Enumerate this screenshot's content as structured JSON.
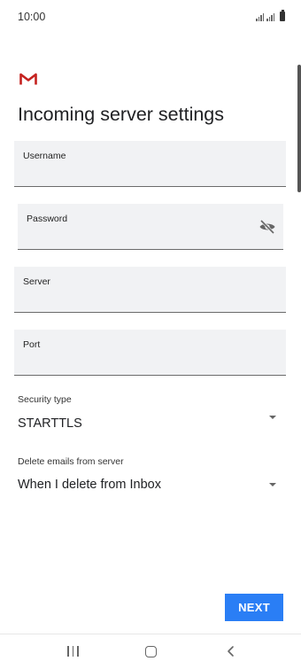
{
  "status_bar": {
    "time": "10:00",
    "signal_icon": "signal-icon",
    "battery_icon": "battery-icon"
  },
  "app": {
    "logo_icon": "gmail-icon",
    "brand_color": "#c5221f"
  },
  "page": {
    "title": "Incoming server settings"
  },
  "form": {
    "username": {
      "label": "Username",
      "value": ""
    },
    "password": {
      "label": "Password",
      "value": "",
      "toggle_icon": "visibility-off-icon"
    },
    "server": {
      "label": "Server",
      "value": ""
    },
    "port": {
      "label": "Port",
      "value": ""
    },
    "security_type": {
      "label": "Security type",
      "value": "STARTTLS"
    },
    "delete_emails": {
      "label": "Delete emails from server",
      "value": "When I delete from Inbox"
    }
  },
  "actions": {
    "next_label": "NEXT",
    "accent_color": "#2a7ef5"
  },
  "nav_bar": {
    "recents_icon": "recents-icon",
    "home_icon": "home-icon",
    "back_icon": "back-icon"
  }
}
